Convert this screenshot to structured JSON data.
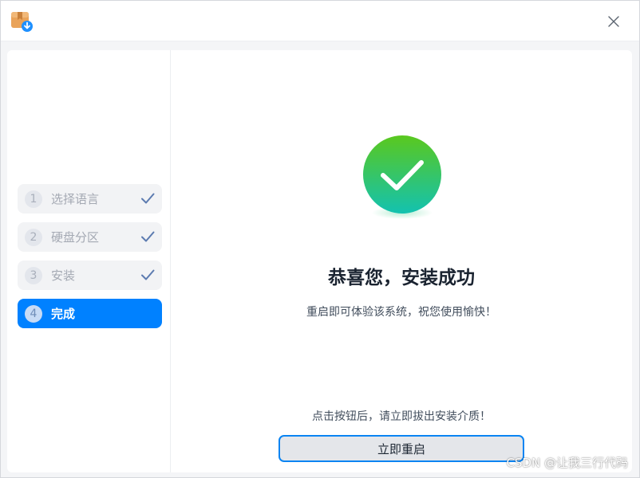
{
  "window": {
    "close_icon": "close-icon",
    "app_icon": "package-download-icon"
  },
  "sidebar": {
    "steps": [
      {
        "number": "1",
        "label": "选择语言",
        "status": "done"
      },
      {
        "number": "2",
        "label": "硬盘分区",
        "status": "done"
      },
      {
        "number": "3",
        "label": "安装",
        "status": "done"
      },
      {
        "number": "4",
        "label": "完成",
        "status": "active"
      }
    ]
  },
  "main": {
    "title": "恭喜您，安装成功",
    "subtitle": "重启即可体验该系统，祝您使用愉快！",
    "notice": "点击按钮后，请立即拔出安装介质！",
    "restart_label": "立即重启"
  },
  "watermark": "CSDN @让我三行代码",
  "colors": {
    "accent": "#0081ff",
    "success_top": "#5ac81e",
    "success_bottom": "#13c2b0",
    "check_done": "#5c7bb0"
  }
}
